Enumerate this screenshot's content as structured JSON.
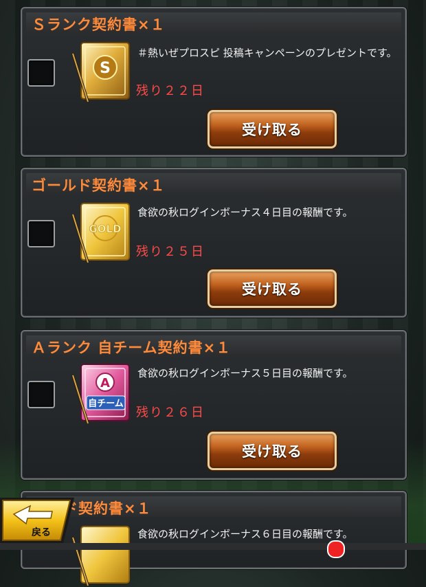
{
  "gifts": [
    {
      "title": "Ｓランク契約書×１",
      "description": "＃熱いぜプロスピ 投稿キャンペーンのプレゼントです。",
      "remaining": "残り２２日",
      "button_label": "受け取る",
      "item_icon": "s-rank-contract-icon",
      "item_badge": "S"
    },
    {
      "title": "ゴールド契約書×１",
      "description": "食欲の秋ログインボーナス４日目の報酬です。",
      "remaining": "残り２５日",
      "button_label": "受け取る",
      "item_icon": "gold-contract-icon",
      "item_badge": "GOLD"
    },
    {
      "title": "Ａランク 自チーム契約書×１",
      "description": "食欲の秋ログインボーナス５日目の報酬です。",
      "remaining": "残り２６日",
      "button_label": "受け取る",
      "item_icon": "a-rank-own-team-contract-icon",
      "item_badge": "A",
      "item_sublabel": "自チーム"
    },
    {
      "title": "ド契約書×１",
      "description": "食欲の秋ログインボーナス６日目の報酬です。",
      "item_icon": "gold-contract-icon"
    }
  ],
  "nav": {
    "back_label": "戻る"
  },
  "colors": {
    "title_orange": "#ff8a3a",
    "remaining_red": "#ff4a4a",
    "button_brown": "#8d3c0c"
  }
}
